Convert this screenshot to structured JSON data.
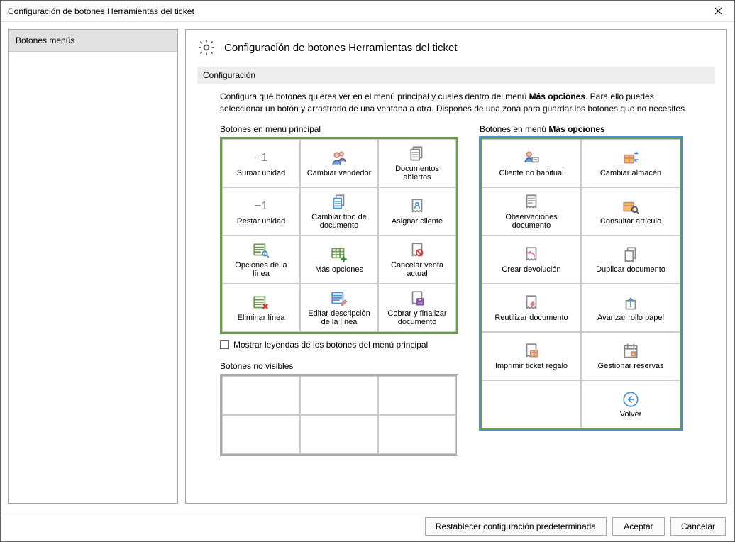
{
  "window": {
    "title": "Configuración de botones Herramientas del ticket"
  },
  "sidebar": {
    "items": [
      {
        "label": "Botones menús"
      }
    ]
  },
  "page": {
    "title": "Configuración de botones Herramientas del ticket",
    "section": "Configuración",
    "description_pre": "Configura qué botones quieres ver en el menú principal y cuales dentro del menú ",
    "description_bold": "Más opciones",
    "description_post": ". Para ello puedes seleccionar un botón y arrastrarlo de una ventana a otra. Dispones de una zona para guardar los botones que no necesites."
  },
  "groups": {
    "main_title": "Botones en menú principal",
    "more_title_pre": "Botones en menú ",
    "more_title_bold": "Más opciones",
    "hidden_title": "Botones no visibles",
    "show_legends": "Mostrar leyendas de los botones del menú principal"
  },
  "main_buttons": [
    {
      "id": "sumar-unidad",
      "label": "Sumar unidad",
      "icon": "plus1"
    },
    {
      "id": "cambiar-vendedor",
      "label": "Cambiar vendedor",
      "icon": "people"
    },
    {
      "id": "documentos-abiertos",
      "label": "Documentos abiertos",
      "icon": "docs"
    },
    {
      "id": "restar-unidad",
      "label": "Restar unidad",
      "icon": "minus1"
    },
    {
      "id": "cambiar-tipo-doc",
      "label": "Cambiar tipo de documento",
      "icon": "doc-copy"
    },
    {
      "id": "asignar-cliente",
      "label": "Asignar cliente",
      "icon": "receipt-user"
    },
    {
      "id": "opciones-linea",
      "label": "Opciones de la línea",
      "icon": "list-lens"
    },
    {
      "id": "mas-opciones",
      "label": "Más opciones",
      "icon": "grid-plus"
    },
    {
      "id": "cancelar-venta",
      "label": "Cancelar venta actual",
      "icon": "receipt-no"
    },
    {
      "id": "eliminar-linea",
      "label": "Eliminar línea",
      "icon": "list-x"
    },
    {
      "id": "editar-desc-linea",
      "label": "Editar descripción de la línea",
      "icon": "list-edit"
    },
    {
      "id": "cobrar-finalizar",
      "label": "Cobrar y finalizar documento",
      "icon": "receipt-save"
    }
  ],
  "more_buttons": [
    {
      "id": "cliente-no-habitual",
      "label": "Cliente no habitual",
      "icon": "person-card"
    },
    {
      "id": "cambiar-almacen",
      "label": "Cambiar almacén",
      "icon": "box-swap"
    },
    {
      "id": "observaciones-doc",
      "label": "Observaciones documento",
      "icon": "receipt-note"
    },
    {
      "id": "consultar-articulo",
      "label": "Consultar artículo",
      "icon": "box-lens"
    },
    {
      "id": "crear-devolucion",
      "label": "Crear devolución",
      "icon": "receipt-back"
    },
    {
      "id": "duplicar-doc",
      "label": "Duplicar documento",
      "icon": "receipt-dup"
    },
    {
      "id": "reutilizar-doc",
      "label": "Reutilizar documento",
      "icon": "receipt-bolt"
    },
    {
      "id": "avanzar-rollo",
      "label": "Avanzar rollo papel",
      "icon": "paper-up"
    },
    {
      "id": "imprimir-regalo",
      "label": "Imprimir ticket regalo",
      "icon": "receipt-gift"
    },
    {
      "id": "gestionar-reservas",
      "label": "Gestionar reservas",
      "icon": "calendar"
    },
    {
      "id": "blank",
      "label": "",
      "icon": "none"
    },
    {
      "id": "volver",
      "label": "Volver",
      "icon": "back"
    }
  ],
  "footer": {
    "reset": "Restablecer configuración predeterminada",
    "accept": "Aceptar",
    "cancel": "Cancelar"
  }
}
